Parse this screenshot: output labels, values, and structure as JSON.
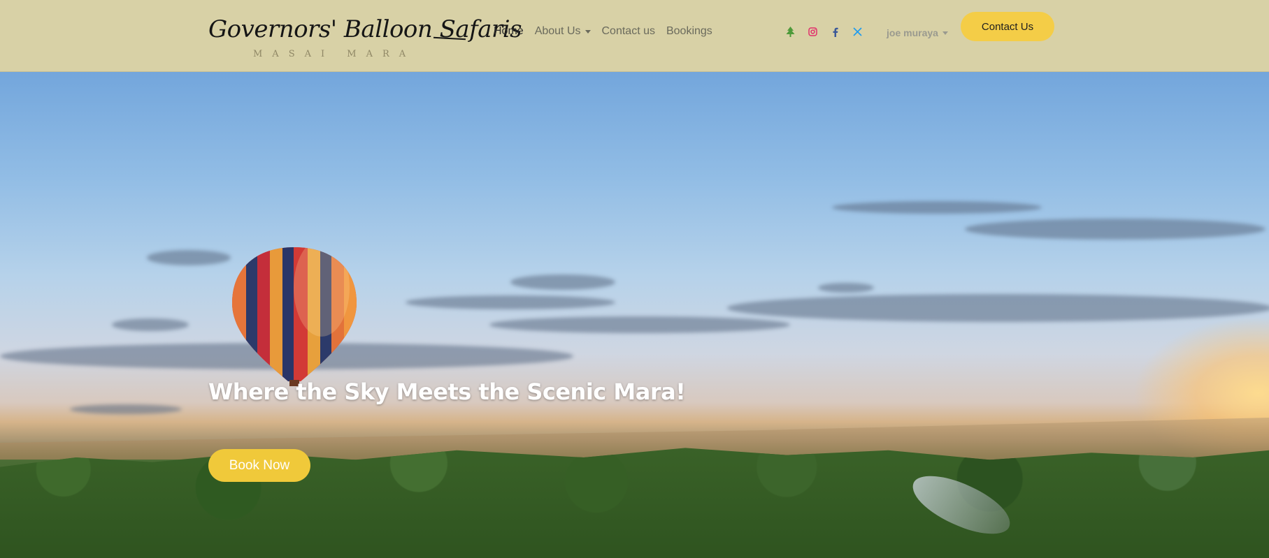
{
  "brand": {
    "name": "Governors' Balloon Safaris",
    "location": "MASAI MARA"
  },
  "nav": {
    "items": [
      {
        "label": "Home",
        "active": true,
        "dropdown": false
      },
      {
        "label": "About Us",
        "active": false,
        "dropdown": true
      },
      {
        "label": "Contact us",
        "active": false,
        "dropdown": false
      },
      {
        "label": "Bookings",
        "active": false,
        "dropdown": false
      }
    ]
  },
  "socials": [
    {
      "icon": "tree-icon",
      "color": "#4e9a3a"
    },
    {
      "icon": "instagram-icon",
      "color": "#e1306c"
    },
    {
      "icon": "facebook-icon",
      "color": "#3b5998"
    },
    {
      "icon": "x-icon",
      "color": "#1d9bf0"
    }
  ],
  "user": {
    "name": "joe muraya"
  },
  "header": {
    "contact_label": "Contact Us"
  },
  "hero": {
    "tagline": "Where the Sky Meets the Scenic Mara!",
    "book_label": "Book Now"
  },
  "colors": {
    "header_bg": "#d8d1a6",
    "accent": "#f4cd47"
  }
}
